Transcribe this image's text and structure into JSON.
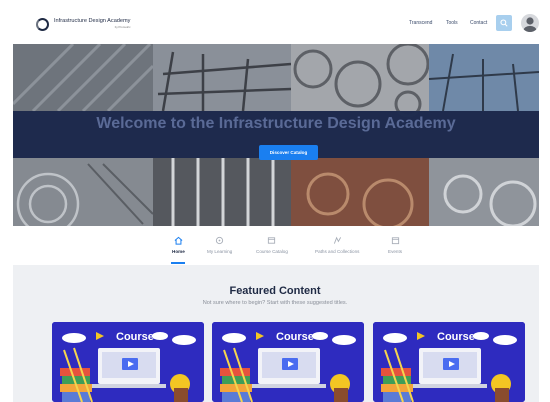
{
  "brand": {
    "title": "Infrastructure Design Academy",
    "subtitle": "by Prometric"
  },
  "top_nav": {
    "items": [
      {
        "label": "Transcend"
      },
      {
        "label": "Tools"
      },
      {
        "label": "Contact"
      }
    ],
    "search_icon": "search-icon",
    "avatar_icon": "user-avatar"
  },
  "hero": {
    "title": "Welcome to the Infrastructure Design Academy",
    "cta_label": "Discover Catalog"
  },
  "tabs": {
    "active": "Home",
    "items": [
      {
        "label": "Home",
        "icon": "home-icon"
      },
      {
        "label": "My Learning",
        "icon": "learning-icon"
      },
      {
        "label": "Course Catalog",
        "icon": "catalog-icon"
      },
      {
        "label": "Paths and Collections",
        "icon": "paths-icon"
      },
      {
        "label": "Events",
        "icon": "calendar-icon"
      }
    ]
  },
  "featured": {
    "title": "Featured Content",
    "subtitle": "Not sure where to begin? Start with these suggested titles.",
    "cards": [
      {
        "label": "Course"
      },
      {
        "label": "Course"
      },
      {
        "label": "Course"
      }
    ]
  },
  "colors": {
    "accent": "#1a7ff0",
    "navy": "#1b284c",
    "card_bg": "#2e2bbf",
    "featured_bg": "#eef0f3"
  }
}
